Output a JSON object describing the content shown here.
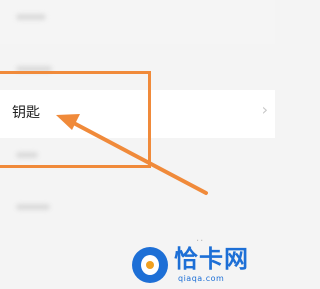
{
  "settings_list": {
    "highlighted_item": {
      "label": "钥匙",
      "chevron": "›"
    }
  },
  "page_indicator": "..",
  "annotation": {
    "color": "#f08a3a"
  },
  "watermark": {
    "title": "恰卡网",
    "url": "qiaqa.com",
    "brand_color": "#1d6fd6"
  }
}
